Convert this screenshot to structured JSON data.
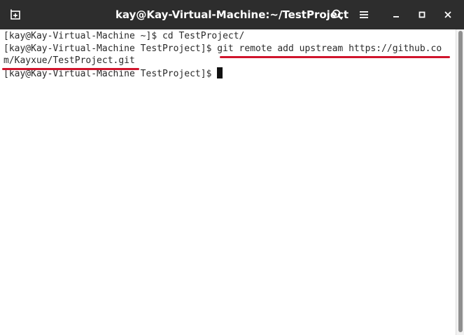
{
  "window": {
    "title": "kay@Kay-Virtual-Machine:~/TestProject"
  },
  "titlebar_icons": {
    "new_tab": "new-tab-icon",
    "search": "search-icon",
    "menu": "hamburger-menu-icon",
    "minimize": "minimize-icon",
    "maximize": "maximize-icon",
    "close": "close-icon"
  },
  "terminal": {
    "lines": [
      {
        "prompt": "[kay@Kay-Virtual-Machine ~]$ ",
        "command": "cd TestProject/"
      },
      {
        "prompt": "[kay@Kay-Virtual-Machine TestProject]$ ",
        "command": "git remote add upstream https://github.co"
      },
      {
        "prompt": "",
        "command": "m/Kayxue/TestProject.git"
      },
      {
        "prompt": "[kay@Kay-Virtual-Machine TestProject]$ ",
        "command": ""
      }
    ]
  },
  "colors": {
    "titlebar_bg": "#2d2d2d",
    "terminal_bg": "#ffffff",
    "text": "#2a2a2a",
    "annotation_underline": "#d0142c"
  }
}
